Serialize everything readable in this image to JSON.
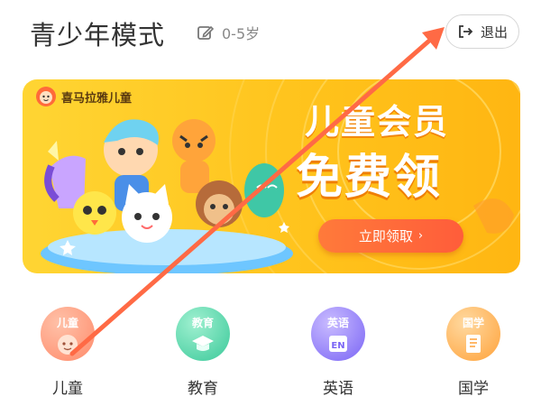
{
  "header": {
    "title": "青少年模式",
    "age_range": "0-5岁",
    "edit_icon": "edit-icon",
    "exit_label": "退出",
    "exit_icon": "logout-icon"
  },
  "banner": {
    "brand": "喜马拉雅儿童",
    "headline": "儿童会员",
    "subheadline": "免费领",
    "cta_label": "立即领取",
    "cta_arrow": "›",
    "colors": {
      "bg_start": "#ffd533",
      "bg_end": "#ffb612",
      "cta": "#ff6a3a"
    }
  },
  "categories": [
    {
      "label": "儿童",
      "badge": "儿童",
      "icon": "child-face-icon",
      "color": "#ff8a6a"
    },
    {
      "label": "教育",
      "badge": "教育",
      "icon": "graduation-cap-icon",
      "color": "#4dd3a6"
    },
    {
      "label": "英语",
      "badge": "英语",
      "icon": "english-book-icon",
      "color": "#8e7bff"
    },
    {
      "label": "国学",
      "badge": "国学",
      "icon": "scroll-icon",
      "color": "#ffb14a"
    }
  ],
  "annotation": {
    "type": "arrow",
    "color": "#ff6a45"
  }
}
